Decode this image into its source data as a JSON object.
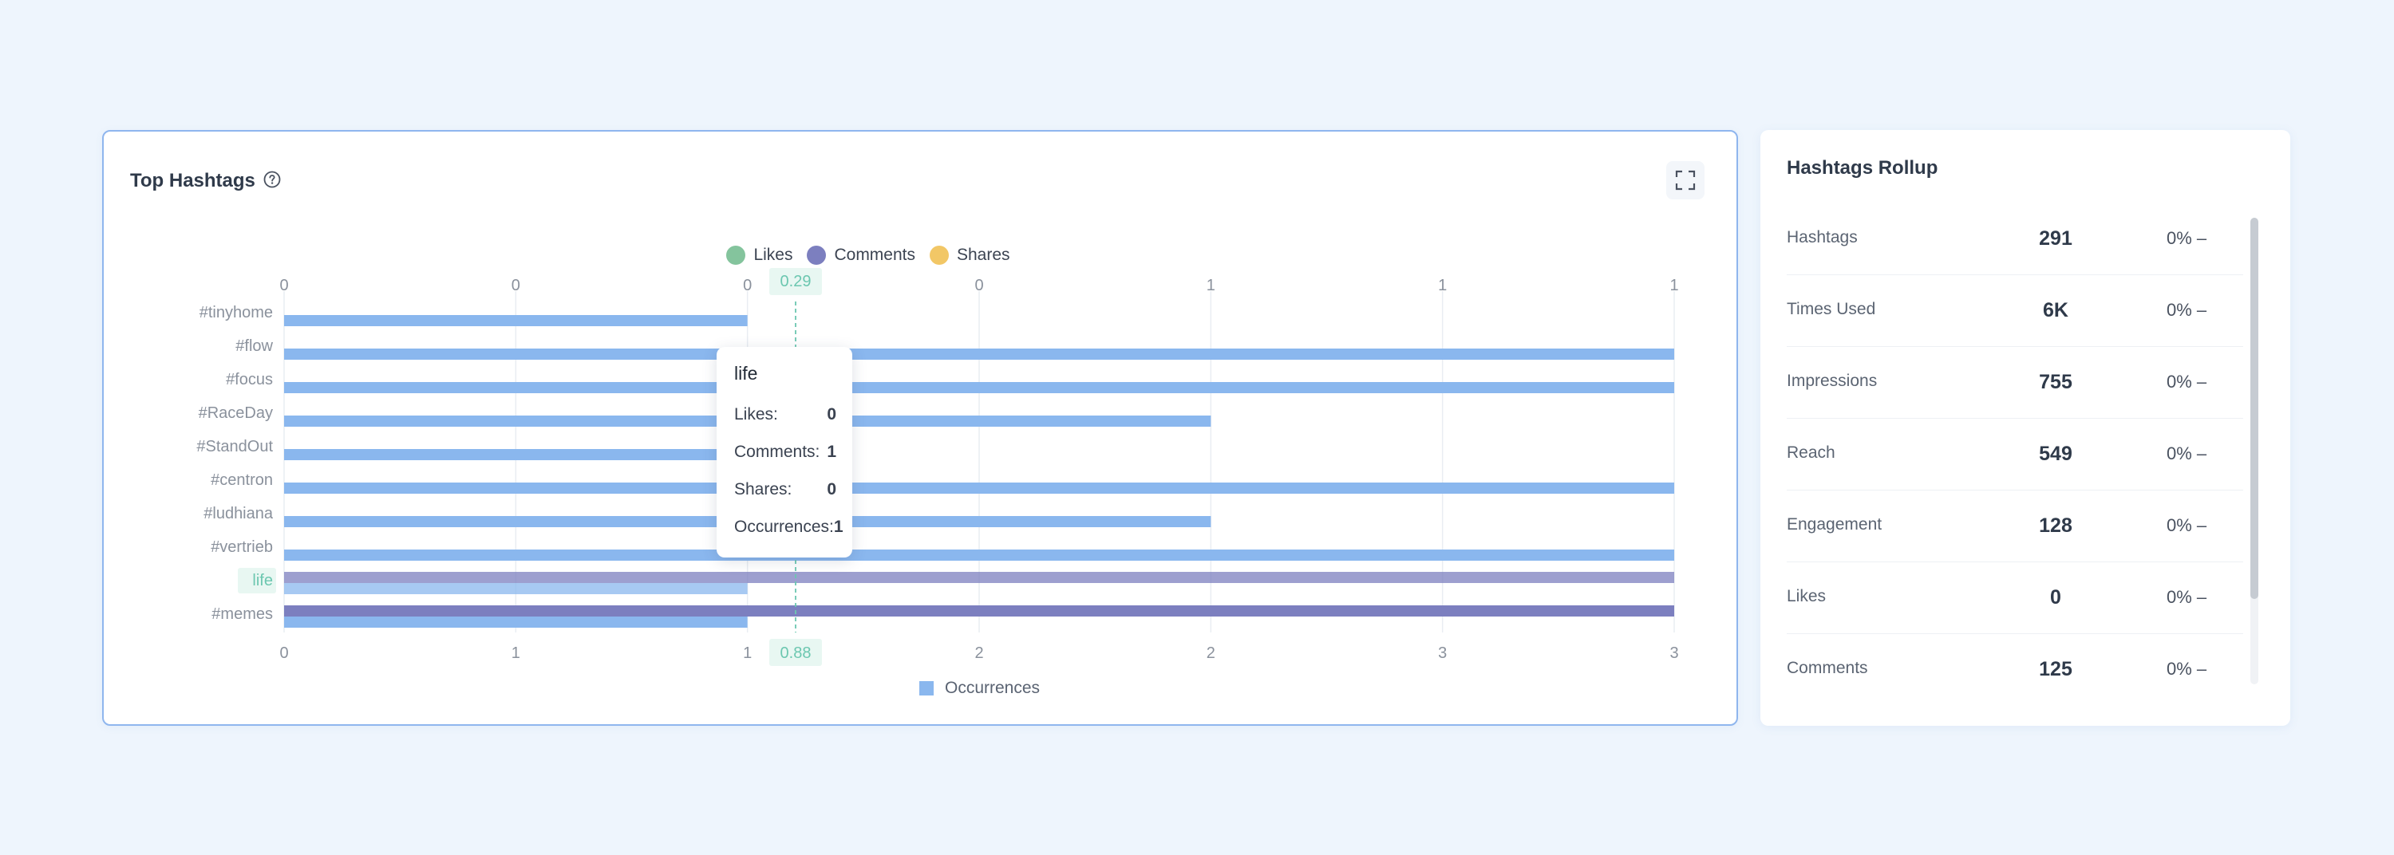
{
  "top_hashtags": {
    "title": "Top Hashtags",
    "tooltip": {
      "title": "life",
      "rows": [
        {
          "label": "Likes:",
          "value": "0"
        },
        {
          "label": "Comments:",
          "value": "1"
        },
        {
          "label": "Shares:",
          "value": "0"
        },
        {
          "label": "Occurrences:",
          "value": "1"
        }
      ]
    },
    "legend": {
      "likes": "Likes",
      "comments": "Comments",
      "shares": "Shares",
      "occurrences": "Occurrences"
    },
    "colors": {
      "likes": "#84c49d",
      "comments": "#7c7fbf",
      "shares": "#f2c766",
      "occurrences": "#8ab7ee",
      "highlight": "#6cc7b0"
    }
  },
  "chart_data": {
    "type": "bar",
    "orientation": "horizontal",
    "categories": [
      "#tinyhome",
      "#flow",
      "#focus",
      "#RaceDay",
      "#StandOut",
      "#centron",
      "#ludhiana",
      "#vertrieb",
      "life",
      "#memes"
    ],
    "series": [
      {
        "name": "Likes",
        "values": [
          0,
          0,
          0,
          0,
          0,
          0,
          0,
          0,
          0,
          0
        ]
      },
      {
        "name": "Comments",
        "values": [
          0,
          0,
          0,
          0,
          0,
          0,
          0,
          0,
          1,
          1
        ]
      },
      {
        "name": "Shares",
        "values": [
          0,
          0,
          0,
          0,
          0,
          0,
          0,
          0,
          0,
          0
        ]
      },
      {
        "name": "Occurrences",
        "values": [
          1,
          3,
          3,
          2,
          1,
          3,
          2,
          3,
          1,
          1
        ]
      }
    ],
    "top_axis": {
      "ticks": [
        "0",
        "0",
        "0",
        "0",
        "1",
        "1",
        "1"
      ],
      "range": [
        0,
        1
      ],
      "cursor_label": "0.29"
    },
    "bottom_axis": {
      "ticks": [
        "0",
        "1",
        "1",
        "2",
        "2",
        "3",
        "3"
      ],
      "range": [
        0,
        3
      ],
      "cursor_label": "0.88"
    },
    "highlighted_category": "life",
    "legend_position": "top-center / bottom-center"
  },
  "rollup": {
    "title": "Hashtags Rollup",
    "rows": [
      {
        "label": "Hashtags",
        "value": "291",
        "change": "0% –"
      },
      {
        "label": "Times Used",
        "value": "6K",
        "change": "0% –"
      },
      {
        "label": "Impressions",
        "value": "755",
        "change": "0% –"
      },
      {
        "label": "Reach",
        "value": "549",
        "change": "0% –"
      },
      {
        "label": "Engagement",
        "value": "128",
        "change": "0% –"
      },
      {
        "label": "Likes",
        "value": "0",
        "change": "0% –"
      },
      {
        "label": "Comments",
        "value": "125",
        "change": "0% –"
      }
    ]
  }
}
